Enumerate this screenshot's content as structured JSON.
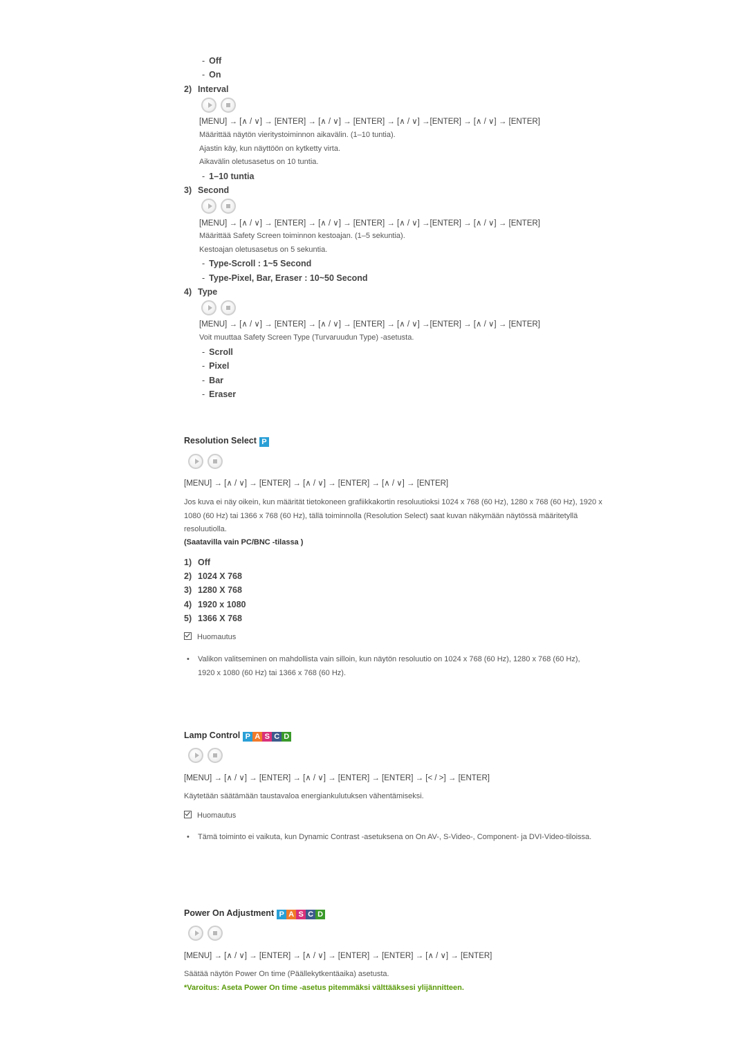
{
  "safety_screen": {
    "timer_options": [
      "Off",
      "On"
    ],
    "interval": {
      "number": "2)",
      "title": "Interval",
      "path": "[MENU] → [∧ / ∨] → [ENTER] → [∧ / ∨] → [ENTER] → [∧ / ∨] →[ENTER] → [∧ / ∨] → [ENTER]",
      "desc": [
        "Määrittää näytön vieritystoiminnon aikavälin. (1–10 tuntia).",
        "Ajastin käy, kun näyttöön on kytketty virta.",
        "Aikavälin oletusasetus on 10 tuntia."
      ],
      "options": [
        "1–10 tuntia"
      ]
    },
    "second": {
      "number": "3)",
      "title": "Second",
      "path": "[MENU] → [∧ / ∨] → [ENTER] → [∧ / ∨] → [ENTER] → [∧ / ∨] →[ENTER] → [∧ / ∨] → [ENTER]",
      "desc": [
        "Määrittää Safety Screen toiminnon kestoajan. (1–5 sekuntia).",
        "Kestoajan oletusasetus on 5 sekuntia."
      ],
      "options": [
        "Type-Scroll : 1~5 Second",
        "Type-Pixel, Bar, Eraser : 10~50 Second"
      ]
    },
    "type": {
      "number": "4)",
      "title": "Type",
      "path": "[MENU] → [∧ / ∨] → [ENTER] → [∧ / ∨] → [ENTER] → [∧ / ∨] →[ENTER] → [∧ / ∨] → [ENTER]",
      "desc": [
        "Voit muuttaa Safety Screen Type (Turvaruudun Type) -asetusta."
      ],
      "options": [
        "Scroll",
        "Pixel",
        "Bar",
        "Eraser"
      ]
    }
  },
  "resolution_select": {
    "title": "Resolution Select",
    "badges": [
      {
        "letter": "P",
        "color": "#2a9fd6"
      }
    ],
    "path": "[MENU] → [∧ / ∨] → [ENTER] → [∧ / ∨] → [ENTER] → [∧ / ∨] → [ENTER]",
    "desc": "Jos kuva ei näy oikein, kun määrität tietokoneen grafiikkakortin resoluutioksi 1024 x 768 (60 Hz), 1280 x 768 (60 Hz), 1920 x 1080 (60 Hz) tai 1366 x 768 (60 Hz), tällä toiminnolla (Resolution Select) saat kuvan näkymään näytössä määritetyllä resoluutiolla.",
    "availability": "(Saatavilla vain PC/BNC -tilassa )",
    "options": [
      {
        "n": "1)",
        "label": "Off"
      },
      {
        "n": "2)",
        "label": "1024 X 768"
      },
      {
        "n": "3)",
        "label": "1280 X 768"
      },
      {
        "n": "4)",
        "label": "1920 x 1080"
      },
      {
        "n": "5)",
        "label": "1366 X 768"
      }
    ],
    "note_label": "Huomautus",
    "note": "Valikon valitseminen on mahdollista vain silloin, kun näytön resoluutio on 1024 x 768 (60 Hz), 1280 x 768 (60 Hz), 1920 x 1080 (60 Hz) tai 1366 x 768 (60 Hz)."
  },
  "lamp_control": {
    "title": "Lamp Control",
    "badges": [
      {
        "letter": "P",
        "color": "#2a9fd6"
      },
      {
        "letter": "A",
        "color": "#f07a2a"
      },
      {
        "letter": "S",
        "color": "#d9307a"
      },
      {
        "letter": "C",
        "color": "#3d5a8c"
      },
      {
        "letter": "D",
        "color": "#3a9a2a"
      }
    ],
    "path": "[MENU] → [∧ / ∨] → [ENTER] → [∧ / ∨] → [ENTER] → [ENTER] → [< / >] → [ENTER]",
    "desc": "Käytetään säätämään taustavaloa energiankulutuksen vähentämiseksi.",
    "note_label": "Huomautus",
    "note": "Tämä toiminto ei vaikuta, kun Dynamic Contrast -asetuksena on On AV-, S-Video-, Component- ja DVI-Video-tiloissa."
  },
  "power_on_adjustment": {
    "title": "Power On Adjustment",
    "badges": [
      {
        "letter": "P",
        "color": "#2a9fd6"
      },
      {
        "letter": "A",
        "color": "#f07a2a"
      },
      {
        "letter": "S",
        "color": "#d9307a"
      },
      {
        "letter": "C",
        "color": "#3d5a8c"
      },
      {
        "letter": "D",
        "color": "#3a9a2a"
      }
    ],
    "path": "[MENU] → [∧ / ∨] → [ENTER] → [∧ / ∨] → [ENTER] → [ENTER] → [∧ / ∨] → [ENTER]",
    "desc": "Säätää näytön Power On time (Päällekytkentäaika) asetusta.",
    "warning": "*Varoitus: Aseta Power On time -asetus pitemmäksi välttääksesi ylijännitteen."
  },
  "icon_names": {
    "play": "play-icon",
    "stop": "stop-icon",
    "check": "checkbox-icon"
  }
}
